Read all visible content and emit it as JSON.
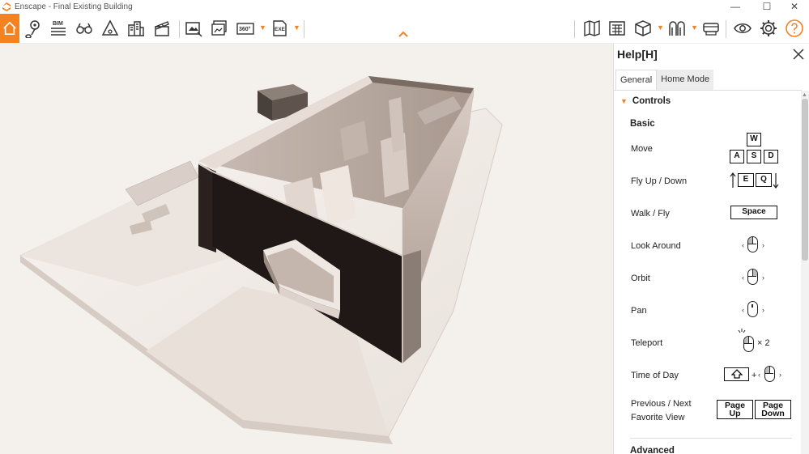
{
  "window": {
    "title": "Enscape - Final Existing Building",
    "min": "—",
    "max": "☐",
    "close": "✕"
  },
  "toolbar": {
    "bim_label": "BIM",
    "pano_label": "360°",
    "exe_label": "EXE",
    "accent": "#f58220"
  },
  "help": {
    "title": "Help[H]",
    "tabs": [
      "General",
      "Home Mode"
    ],
    "section": "Controls",
    "subsection": "Basic",
    "rows": {
      "move": "Move",
      "fly": "Fly Up / Down",
      "walk": "Walk / Fly",
      "look": "Look Around",
      "orbit": "Orbit",
      "pan": "Pan",
      "teleport": "Teleport",
      "time": "Time of Day",
      "prev_1": "Previous / Next",
      "prev_2": "Favorite View"
    },
    "keys": {
      "w": "W",
      "a": "A",
      "s": "S",
      "d": "D",
      "e": "E",
      "q": "Q",
      "space": "Space",
      "pageup_1": "Page",
      "pageup_2": "Up",
      "pagedown_1": "Page",
      "pagedown_2": "Down",
      "plus": "+",
      "x2": "× 2"
    },
    "advanced": "Advanced"
  }
}
